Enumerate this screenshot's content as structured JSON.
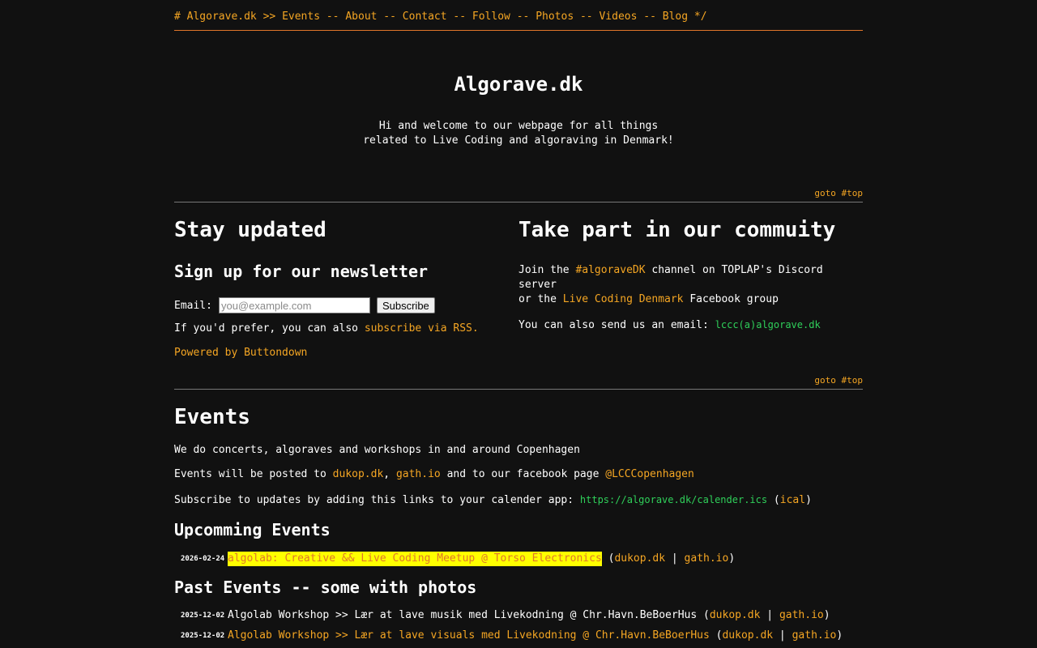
{
  "nav": {
    "prefix": "# Algorave.dk >> ",
    "items": [
      "Events",
      "About",
      "Contact",
      "Follow",
      "Photos",
      "Videos",
      "Blog"
    ],
    "separator": " -- ",
    "suffix": " */"
  },
  "hero": {
    "title": "Algorave.dk",
    "line1": "Hi and welcome to our webpage for all things",
    "line2": "related to Live Coding and algoraving in Denmark!"
  },
  "goto_top": "goto #top",
  "newsletter": {
    "heading": "Stay updated",
    "subheading": "Sign up for our newsletter",
    "email_label": "Email:",
    "email_placeholder": "you@example.com",
    "subscribe_label": "Subscribe",
    "rss_prefix": "If you'd prefer, you can also ",
    "rss_link": "subscribe via RSS.",
    "powered": "Powered by Buttondown"
  },
  "community": {
    "heading": "Take part in our commuity",
    "join_prefix": "Join the ",
    "discord_link": "#algoraveDK",
    "join_mid": " channel on TOPLAP's Discord server",
    "or_prefix": "or the ",
    "facebook_link": "Live Coding Denmark",
    "or_suffix": " Facebook group",
    "mail_prefix": "You can also send us an email: ",
    "mail_addr": "lccc(a)algorave.dk"
  },
  "events": {
    "heading": "Events",
    "intro": "We do concerts, algoraves and workshops in and around Copenhagen",
    "posted_prefix": "Events will be posted to ",
    "posted_link1": "dukop.dk",
    "posted_comma": ", ",
    "posted_link2": "gath.io",
    "posted_mid": " and to our facebook page ",
    "posted_link3": "@LCCCopenhagen",
    "sub_prefix": "Subscribe to updates by adding this links to your calender app: ",
    "sub_url": "https://algorave.dk/calender.ics",
    "sub_ical": "ical",
    "upcoming_heading": "Upcomming Events",
    "upcoming": [
      {
        "date": "2026-02-24",
        "title": "algolab: Creative && Live Coding Meetup @ Torso Electronics",
        "link1": "dukop.dk",
        "link2": "gath.io"
      }
    ],
    "past_heading": "Past Events -- some with photos",
    "past": [
      {
        "date": "2025-12-02",
        "title": "Algolab Workshop >> Lær at lave musik med Livekodning @ Chr.Havn.BeBoerHus",
        "link1": "dukop.dk",
        "link2": "gath.io"
      },
      {
        "date": "2025-12-02",
        "title": "Algolab Workshop >> Lær at lave visuals med Livekodning @ Chr.Havn.BeBoerHus",
        "link1": "dukop.dk",
        "link2": "gath.io"
      }
    ]
  }
}
